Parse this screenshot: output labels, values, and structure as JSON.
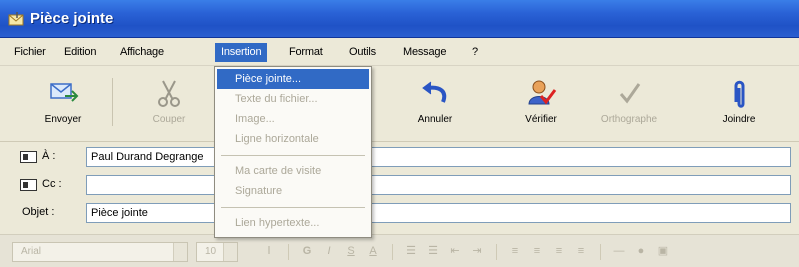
{
  "window": {
    "title": "Pièce jointe",
    "icon": "envelope-paperclip-icon"
  },
  "menubar": {
    "items": [
      "Fichier",
      "Edition",
      "Affichage",
      "Insertion",
      "Format",
      "Outils",
      "Message",
      "?"
    ],
    "active": "Insertion"
  },
  "toolbar": {
    "buttons": [
      {
        "label": "Envoyer",
        "icon": "send-icon",
        "enabled": true
      },
      {
        "label": "Couper",
        "icon": "scissors-icon",
        "enabled": false
      },
      {
        "label": "Annuler",
        "icon": "undo-icon",
        "enabled": true
      },
      {
        "label": "Vérifier",
        "icon": "check-names-icon",
        "enabled": true
      },
      {
        "label": "Orthographe",
        "icon": "spellcheck-icon",
        "enabled": false
      },
      {
        "label": "Joindre",
        "icon": "paperclip-icon",
        "enabled": true
      }
    ]
  },
  "insertion_menu": {
    "items": [
      {
        "label": "Pièce jointe...",
        "enabled": true,
        "highlighted": true
      },
      {
        "label": "Texte du fichier...",
        "enabled": false
      },
      {
        "label": "Image...",
        "enabled": false
      },
      {
        "label": "Ligne horizontale",
        "enabled": false
      },
      {
        "label": "Ma carte de visite",
        "enabled": false
      },
      {
        "label": "Signature",
        "enabled": false
      },
      {
        "label": "Lien hypertexte...",
        "enabled": false
      }
    ]
  },
  "headers": {
    "to_label": "À :",
    "to_value": "Paul Durand Degrange",
    "cc_label": "Cc :",
    "cc_value": "",
    "subject_label": "Objet :",
    "subject_value": "Pièce jointe"
  },
  "formatbar": {
    "font": "Arial",
    "size": "10"
  },
  "colors": {
    "titlebar": "#2a62d6",
    "menu_highlight": "#316ac5",
    "disabled_text": "#aca899",
    "chrome": "#ece9d8"
  }
}
